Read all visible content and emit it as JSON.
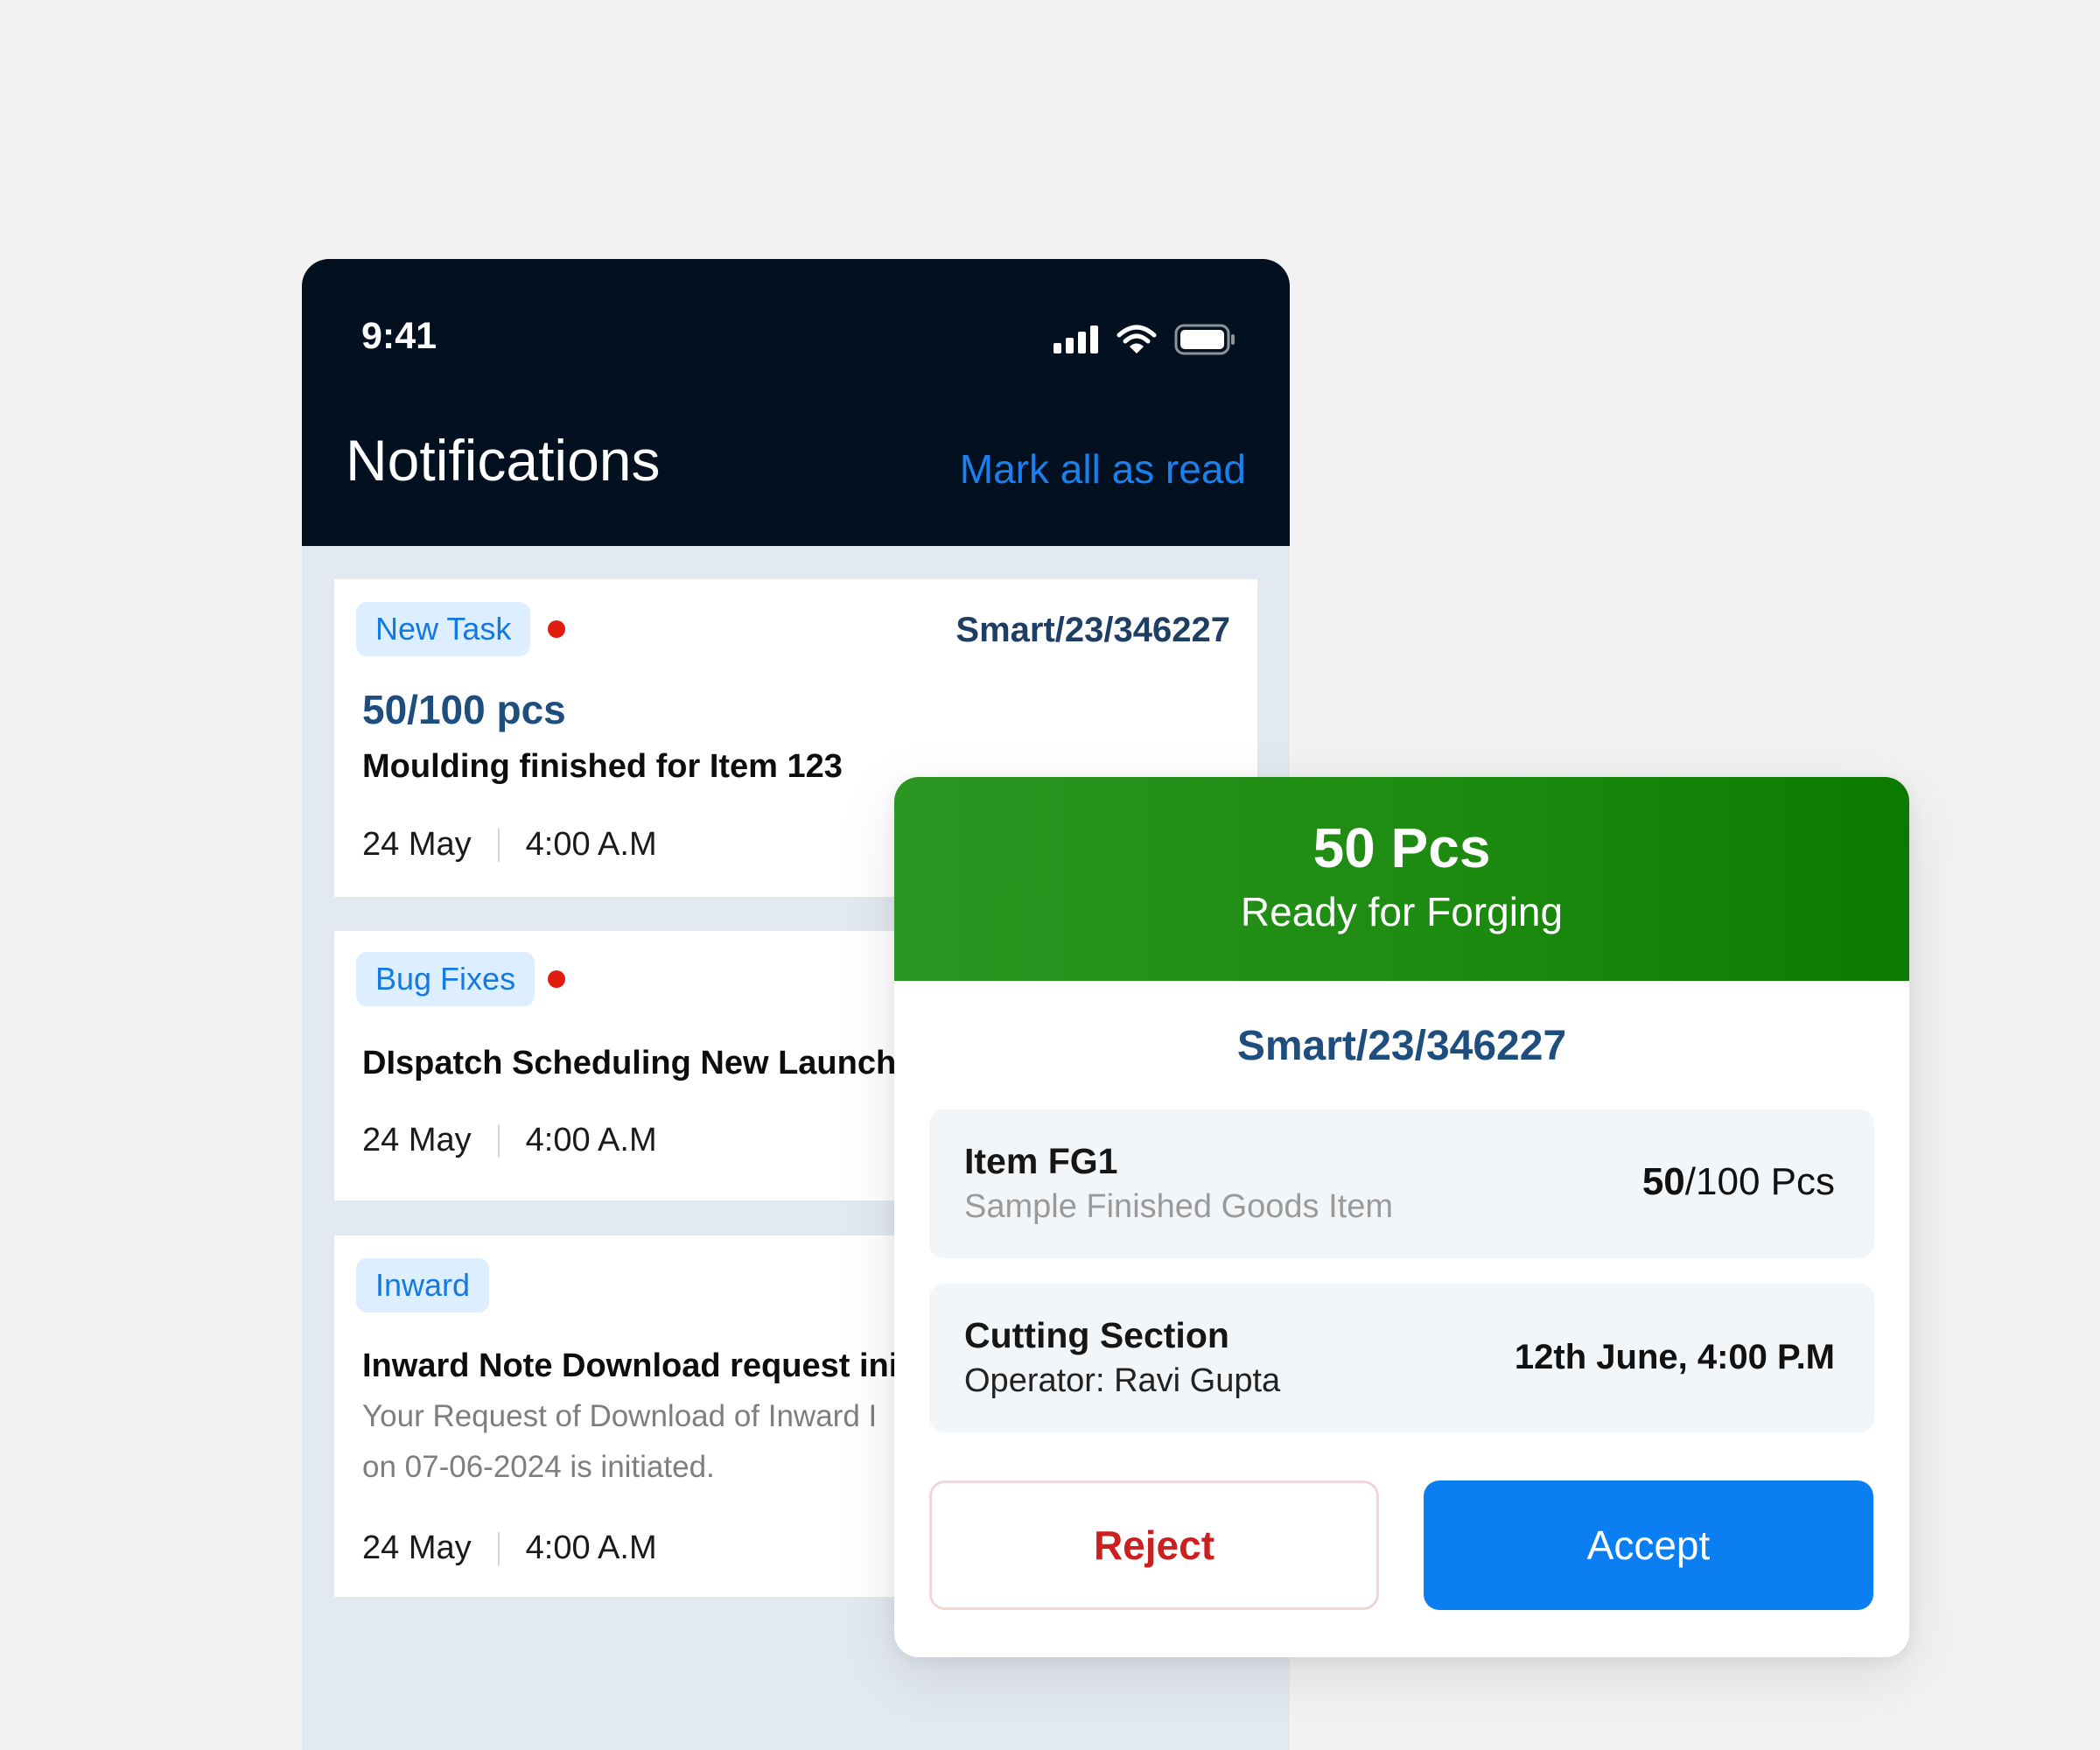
{
  "status_bar": {
    "time": "9:41",
    "icons": [
      "signal-icon",
      "wifi-icon",
      "battery-icon"
    ]
  },
  "header": {
    "title": "Notifications",
    "mark_all_label": "Mark all as read"
  },
  "notifications": [
    {
      "tag": "New Task",
      "unread": true,
      "ref": "Smart/23/346227",
      "qty": "50/100 pcs",
      "title": "Moulding finished for Item 123",
      "date": "24 May",
      "time": "4:00 A.M"
    },
    {
      "tag": "Bug Fixes",
      "unread": true,
      "title": "DIspatch Scheduling New Launch",
      "date": "24 May",
      "time": "4:00 A.M"
    },
    {
      "tag": "Inward",
      "unread": false,
      "title": "Inward Note Download request ini",
      "desc_line1": "Your Request of Download of Inward I",
      "desc_line2": "on 07-06-2024 is initiated.",
      "date": "24 May",
      "time": "4:00 A.M"
    }
  ],
  "modal": {
    "banner_qty": "50 Pcs",
    "banner_status": "Ready for Forging",
    "ref": "Smart/23/346227",
    "item": {
      "name": "Item FG1",
      "desc": "Sample Finished Goods Item",
      "qty_done": "50",
      "qty_total": "/100 Pcs"
    },
    "section": {
      "name": "Cutting Section",
      "operator": "Operator: Ravi Gupta",
      "datetime": "12th June, 4:00 P.M"
    },
    "reject_label": "Reject",
    "accept_label": "Accept"
  },
  "colors": {
    "header_bg": "#02101f",
    "accent_blue": "#1a80ee",
    "accept_blue": "#0b7ff2",
    "banner_green": "#1d8a10",
    "reject_red": "#cc1f1f",
    "unread_dot": "#e11d12",
    "tag_bg": "#ddeefe",
    "ref_navy": "#1e4e7e"
  }
}
